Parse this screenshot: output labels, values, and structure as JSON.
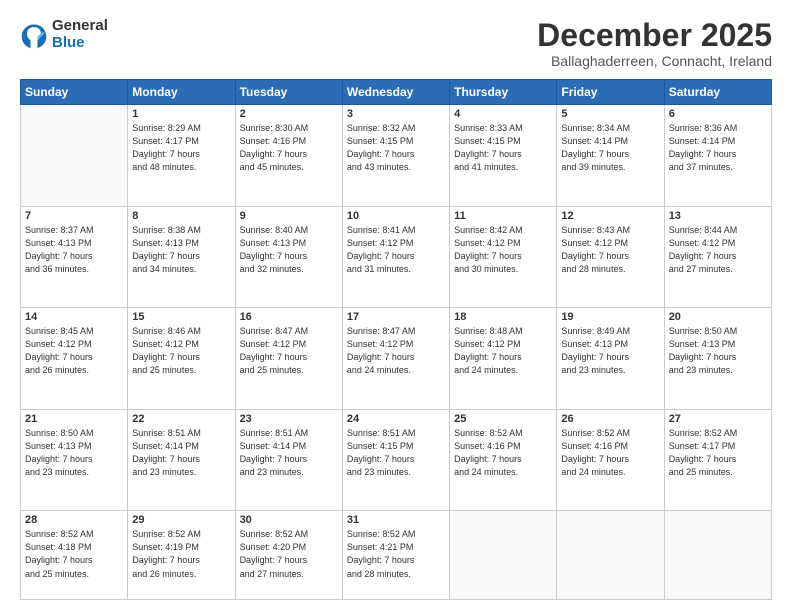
{
  "logo": {
    "general": "General",
    "blue": "Blue"
  },
  "header": {
    "title": "December 2025",
    "location": "Ballaghaderreen, Connacht, Ireland"
  },
  "days_of_week": [
    "Sunday",
    "Monday",
    "Tuesday",
    "Wednesday",
    "Thursday",
    "Friday",
    "Saturday"
  ],
  "weeks": [
    [
      {
        "day": "",
        "info": ""
      },
      {
        "day": "1",
        "info": "Sunrise: 8:29 AM\nSunset: 4:17 PM\nDaylight: 7 hours\nand 48 minutes."
      },
      {
        "day": "2",
        "info": "Sunrise: 8:30 AM\nSunset: 4:16 PM\nDaylight: 7 hours\nand 45 minutes."
      },
      {
        "day": "3",
        "info": "Sunrise: 8:32 AM\nSunset: 4:15 PM\nDaylight: 7 hours\nand 43 minutes."
      },
      {
        "day": "4",
        "info": "Sunrise: 8:33 AM\nSunset: 4:15 PM\nDaylight: 7 hours\nand 41 minutes."
      },
      {
        "day": "5",
        "info": "Sunrise: 8:34 AM\nSunset: 4:14 PM\nDaylight: 7 hours\nand 39 minutes."
      },
      {
        "day": "6",
        "info": "Sunrise: 8:36 AM\nSunset: 4:14 PM\nDaylight: 7 hours\nand 37 minutes."
      }
    ],
    [
      {
        "day": "7",
        "info": "Sunrise: 8:37 AM\nSunset: 4:13 PM\nDaylight: 7 hours\nand 36 minutes."
      },
      {
        "day": "8",
        "info": "Sunrise: 8:38 AM\nSunset: 4:13 PM\nDaylight: 7 hours\nand 34 minutes."
      },
      {
        "day": "9",
        "info": "Sunrise: 8:40 AM\nSunset: 4:13 PM\nDaylight: 7 hours\nand 32 minutes."
      },
      {
        "day": "10",
        "info": "Sunrise: 8:41 AM\nSunset: 4:12 PM\nDaylight: 7 hours\nand 31 minutes."
      },
      {
        "day": "11",
        "info": "Sunrise: 8:42 AM\nSunset: 4:12 PM\nDaylight: 7 hours\nand 30 minutes."
      },
      {
        "day": "12",
        "info": "Sunrise: 8:43 AM\nSunset: 4:12 PM\nDaylight: 7 hours\nand 28 minutes."
      },
      {
        "day": "13",
        "info": "Sunrise: 8:44 AM\nSunset: 4:12 PM\nDaylight: 7 hours\nand 27 minutes."
      }
    ],
    [
      {
        "day": "14",
        "info": "Sunrise: 8:45 AM\nSunset: 4:12 PM\nDaylight: 7 hours\nand 26 minutes."
      },
      {
        "day": "15",
        "info": "Sunrise: 8:46 AM\nSunset: 4:12 PM\nDaylight: 7 hours\nand 25 minutes."
      },
      {
        "day": "16",
        "info": "Sunrise: 8:47 AM\nSunset: 4:12 PM\nDaylight: 7 hours\nand 25 minutes."
      },
      {
        "day": "17",
        "info": "Sunrise: 8:47 AM\nSunset: 4:12 PM\nDaylight: 7 hours\nand 24 minutes."
      },
      {
        "day": "18",
        "info": "Sunrise: 8:48 AM\nSunset: 4:12 PM\nDaylight: 7 hours\nand 24 minutes."
      },
      {
        "day": "19",
        "info": "Sunrise: 8:49 AM\nSunset: 4:13 PM\nDaylight: 7 hours\nand 23 minutes."
      },
      {
        "day": "20",
        "info": "Sunrise: 8:50 AM\nSunset: 4:13 PM\nDaylight: 7 hours\nand 23 minutes."
      }
    ],
    [
      {
        "day": "21",
        "info": "Sunrise: 8:50 AM\nSunset: 4:13 PM\nDaylight: 7 hours\nand 23 minutes."
      },
      {
        "day": "22",
        "info": "Sunrise: 8:51 AM\nSunset: 4:14 PM\nDaylight: 7 hours\nand 23 minutes."
      },
      {
        "day": "23",
        "info": "Sunrise: 8:51 AM\nSunset: 4:14 PM\nDaylight: 7 hours\nand 23 minutes."
      },
      {
        "day": "24",
        "info": "Sunrise: 8:51 AM\nSunset: 4:15 PM\nDaylight: 7 hours\nand 23 minutes."
      },
      {
        "day": "25",
        "info": "Sunrise: 8:52 AM\nSunset: 4:16 PM\nDaylight: 7 hours\nand 24 minutes."
      },
      {
        "day": "26",
        "info": "Sunrise: 8:52 AM\nSunset: 4:16 PM\nDaylight: 7 hours\nand 24 minutes."
      },
      {
        "day": "27",
        "info": "Sunrise: 8:52 AM\nSunset: 4:17 PM\nDaylight: 7 hours\nand 25 minutes."
      }
    ],
    [
      {
        "day": "28",
        "info": "Sunrise: 8:52 AM\nSunset: 4:18 PM\nDaylight: 7 hours\nand 25 minutes."
      },
      {
        "day": "29",
        "info": "Sunrise: 8:52 AM\nSunset: 4:19 PM\nDaylight: 7 hours\nand 26 minutes."
      },
      {
        "day": "30",
        "info": "Sunrise: 8:52 AM\nSunset: 4:20 PM\nDaylight: 7 hours\nand 27 minutes."
      },
      {
        "day": "31",
        "info": "Sunrise: 8:52 AM\nSunset: 4:21 PM\nDaylight: 7 hours\nand 28 minutes."
      },
      {
        "day": "",
        "info": ""
      },
      {
        "day": "",
        "info": ""
      },
      {
        "day": "",
        "info": ""
      }
    ]
  ]
}
